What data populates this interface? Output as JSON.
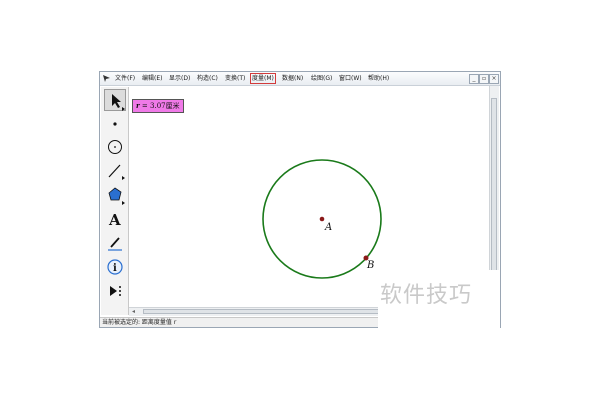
{
  "menubar": {
    "items": [
      {
        "label": "文件(F)"
      },
      {
        "label": "编辑(E)"
      },
      {
        "label": "显示(D)"
      },
      {
        "label": "构造(C)"
      },
      {
        "label": "变换(T)"
      },
      {
        "label": "度量(M)",
        "highlighted": true
      },
      {
        "label": "数据(N)"
      },
      {
        "label": "绘图(G)"
      },
      {
        "label": "窗口(W)"
      },
      {
        "label": "帮助(H)"
      }
    ],
    "window_buttons": {
      "minimize": "_",
      "restore": "▫",
      "close": "×"
    }
  },
  "toolbox": {
    "tools": [
      {
        "icon": "arrow-select-icon"
      },
      {
        "icon": "point-tool-icon"
      },
      {
        "icon": "compass-tool-icon"
      },
      {
        "icon": "straightedge-tool-icon"
      },
      {
        "icon": "polygon-tool-icon"
      },
      {
        "icon": "text-tool-icon",
        "glyph": "A"
      },
      {
        "icon": "marker-tool-icon"
      },
      {
        "icon": "information-tool-icon",
        "glyph": "i"
      },
      {
        "icon": "custom-tool-icon"
      }
    ]
  },
  "canvas": {
    "measurement": {
      "variable": "r",
      "text": " = 3.07厘米"
    },
    "points": {
      "a": "A",
      "b": "B"
    },
    "colors": {
      "circle": "#1a7a1a",
      "point": "#8b1a1a",
      "measure_bg": "#f07ae8"
    }
  },
  "status": {
    "text": "当前被选定的: 距离度量值 r"
  },
  "watermark": {
    "text": "软件技巧"
  }
}
